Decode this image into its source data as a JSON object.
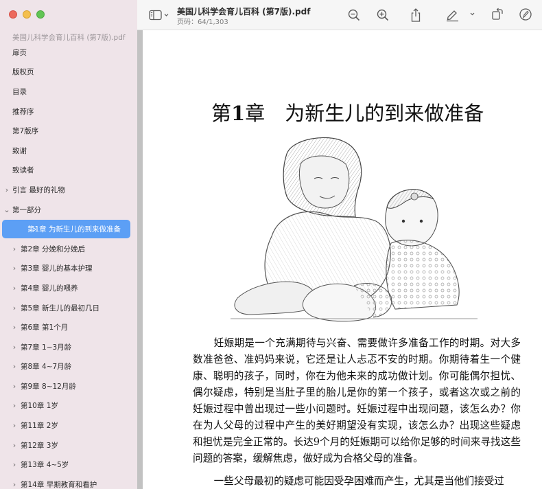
{
  "sidebar": {
    "doc_title": "美国儿科学会育儿百科 (第7版).pdf",
    "items": [
      {
        "label": "扉页",
        "level": 0,
        "chevron": ""
      },
      {
        "label": "版权页",
        "level": 0,
        "chevron": ""
      },
      {
        "label": "目录",
        "level": 0,
        "chevron": ""
      },
      {
        "label": "推荐序",
        "level": 0,
        "chevron": ""
      },
      {
        "label": "第7版序",
        "level": 0,
        "chevron": ""
      },
      {
        "label": "致谢",
        "level": 0,
        "chevron": ""
      },
      {
        "label": "致读者",
        "level": 0,
        "chevron": ""
      },
      {
        "label": "引言 最好的礼物",
        "level": 0,
        "chevron": "›"
      },
      {
        "label": "第一部分",
        "level": 0,
        "chevron": "⌄"
      },
      {
        "label": "第1章 为新生儿的到来做准备",
        "level": 1,
        "chevron": "›",
        "selected": true
      },
      {
        "label": "第2章 分娩和分娩后",
        "level": 1,
        "chevron": "›"
      },
      {
        "label": "第3章 婴儿的基本护理",
        "level": 1,
        "chevron": "›"
      },
      {
        "label": "第4章 婴儿的喂养",
        "level": 1,
        "chevron": "›"
      },
      {
        "label": "第5章 新生儿的最初几日",
        "level": 1,
        "chevron": "›"
      },
      {
        "label": "第6章 第1个月",
        "level": 1,
        "chevron": "›"
      },
      {
        "label": "第7章 1~3月龄",
        "level": 1,
        "chevron": "›"
      },
      {
        "label": "第8章 4~7月龄",
        "level": 1,
        "chevron": "›"
      },
      {
        "label": "第9章 8~12月龄",
        "level": 1,
        "chevron": "›"
      },
      {
        "label": "第10章 1岁",
        "level": 1,
        "chevron": "›"
      },
      {
        "label": "第11章 2岁",
        "level": 1,
        "chevron": "›"
      },
      {
        "label": "第12章 3岁",
        "level": 1,
        "chevron": "›"
      },
      {
        "label": "第13章 4~5岁",
        "level": 1,
        "chevron": "›"
      },
      {
        "label": "第14章 早期教育和看护",
        "level": 1,
        "chevron": "›"
      }
    ]
  },
  "toolbar": {
    "title": "美国儿科学会育儿百科 (第7版).pdf",
    "page_info": "页码：64/1,303",
    "icons": [
      "sidebar-toggle-icon",
      "zoom-out-icon",
      "zoom-in-icon",
      "share-icon",
      "highlight-pen-icon",
      "rotate-icon",
      "markup-icon"
    ]
  },
  "page": {
    "chapter_prefix": "第",
    "chapter_number": "1",
    "chapter_suffix": "章　为新生儿的到来做准备",
    "paragraphs": [
      "妊娠期是一个充满期待与兴奋、需要做许多准备工作的时期。对大多数准爸爸、准妈妈来说，它还是让人忐忑不安的时期。你期待着生一个健康、聪明的孩子，同时，你在为他未来的成功做计划。你可能偶尔担忧、偶尔疑虑，特别是当肚子里的胎儿是你的第一个孩子，或者这次或之前的妊娠过程中曾出现过一些小问题时。妊娠过程中出现问题，该怎么办？你在为人父母的过程中产生的美好期望没有实现，该怎么办？出现这些疑虑和担忧是完全正常的。长达9个月的妊娠期可以给你足够的时间来寻找这些问题的答案，缓解焦虑，做好成为合格父母的准备。",
      "一些父母最初的疑虑可能因受孕困难而产生，尤其是当他们接受过"
    ]
  },
  "colors": {
    "sidebar_bg": "#efe4e9",
    "selection": "#5c9ff5",
    "traffic_red": "#ec6a5e",
    "traffic_yellow": "#f4bf4f",
    "traffic_green": "#61c554"
  }
}
